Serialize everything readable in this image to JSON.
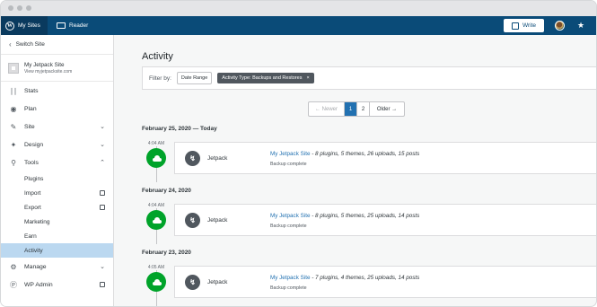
{
  "topbar": {
    "my_sites": "My Sites",
    "reader": "Reader",
    "write": "Write"
  },
  "sidebar": {
    "switch_site": "Switch Site",
    "site_name": "My Jetpack Site",
    "site_url": "View myjetpacksite.com",
    "items": [
      {
        "label": "Stats",
        "icon": "stats-icon"
      },
      {
        "label": "Plan",
        "icon": "plan-icon"
      },
      {
        "label": "Site",
        "icon": "pencil-icon"
      },
      {
        "label": "Design",
        "icon": "design-icon"
      },
      {
        "label": "Tools",
        "icon": "wrench-icon"
      }
    ],
    "tools_sub": [
      "Plugins",
      "Import",
      "Export",
      "Marketing",
      "Earn",
      "Activity"
    ],
    "manage": "Manage",
    "wp_admin": "WP Admin"
  },
  "main": {
    "title": "Activity",
    "filter_label": "Filter by:",
    "date_range": "Date Range",
    "activity_type": "Activity Type: Backups and Restores",
    "pager": {
      "newer": "← Newer",
      "page1": "1",
      "page2": "2",
      "older": "Older →"
    },
    "days": [
      {
        "date": "February 25, 2020 — Today",
        "time": "4:04 AM",
        "actor": "Jetpack",
        "site": "My Jetpack Site",
        "details": " - 8 plugins, 5 themes, 26 uploads, 15 posts",
        "status": "Backup complete"
      },
      {
        "date": "February 24, 2020",
        "time": "4:04 AM",
        "actor": "Jetpack",
        "site": "My Jetpack Site",
        "details": " - 8 plugins, 5 themes, 25 uploads, 14 posts",
        "status": "Backup complete"
      },
      {
        "date": "February 23, 2020",
        "time": "4:05 AM",
        "actor": "Jetpack",
        "site": "My Jetpack Site",
        "details": " - 7 plugins, 4 themes, 25 uploads, 14 posts",
        "status": "Backup complete"
      }
    ]
  },
  "colors": {
    "topbar": "#0a4b78",
    "accent": "#2271b1",
    "success": "#00a32a",
    "active_menu": "#bbd8f0"
  }
}
